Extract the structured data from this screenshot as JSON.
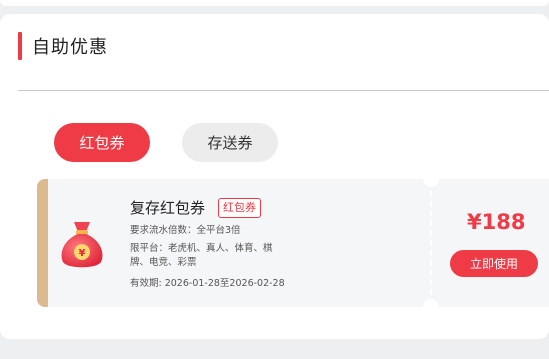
{
  "section": {
    "title": "自助优惠"
  },
  "tabs": [
    {
      "label": "红包券",
      "active": true
    },
    {
      "label": "存送券",
      "active": false
    }
  ],
  "coupon": {
    "name": "复存红包券",
    "tag": "红包券",
    "requirement": "要求流水倍数：全平台3倍",
    "platforms": "限平台：老虎机、真人、体育、棋牌、电竞、彩票",
    "validity": "有效期: 2026-01-28至2026-02-28",
    "amount": "¥188",
    "use_button": "立即使用",
    "icon": "money-bag-icon",
    "bag_symbol": "¥"
  },
  "colors": {
    "accent": "#ee3b46",
    "stripe": "#dcb98e",
    "tab_inactive": "#ececec"
  }
}
